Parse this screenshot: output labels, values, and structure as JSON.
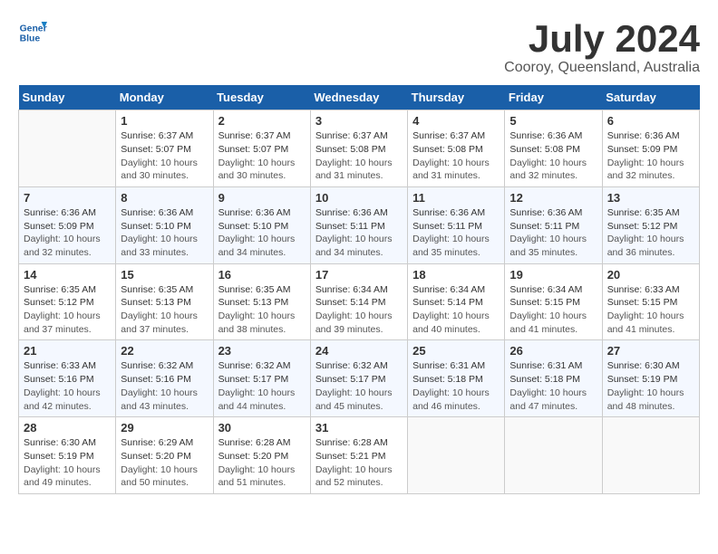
{
  "header": {
    "logo_line1": "General",
    "logo_line2": "Blue",
    "month": "July 2024",
    "location": "Cooroy, Queensland, Australia"
  },
  "days_of_week": [
    "Sunday",
    "Monday",
    "Tuesday",
    "Wednesday",
    "Thursday",
    "Friday",
    "Saturday"
  ],
  "weeks": [
    [
      {
        "day": "",
        "info": ""
      },
      {
        "day": "1",
        "sunrise": "Sunrise: 6:37 AM",
        "sunset": "Sunset: 5:07 PM",
        "daylight": "Daylight: 10 hours and 30 minutes."
      },
      {
        "day": "2",
        "sunrise": "Sunrise: 6:37 AM",
        "sunset": "Sunset: 5:07 PM",
        "daylight": "Daylight: 10 hours and 30 minutes."
      },
      {
        "day": "3",
        "sunrise": "Sunrise: 6:37 AM",
        "sunset": "Sunset: 5:08 PM",
        "daylight": "Daylight: 10 hours and 31 minutes."
      },
      {
        "day": "4",
        "sunrise": "Sunrise: 6:37 AM",
        "sunset": "Sunset: 5:08 PM",
        "daylight": "Daylight: 10 hours and 31 minutes."
      },
      {
        "day": "5",
        "sunrise": "Sunrise: 6:36 AM",
        "sunset": "Sunset: 5:08 PM",
        "daylight": "Daylight: 10 hours and 32 minutes."
      },
      {
        "day": "6",
        "sunrise": "Sunrise: 6:36 AM",
        "sunset": "Sunset: 5:09 PM",
        "daylight": "Daylight: 10 hours and 32 minutes."
      }
    ],
    [
      {
        "day": "7",
        "sunrise": "Sunrise: 6:36 AM",
        "sunset": "Sunset: 5:09 PM",
        "daylight": "Daylight: 10 hours and 32 minutes."
      },
      {
        "day": "8",
        "sunrise": "Sunrise: 6:36 AM",
        "sunset": "Sunset: 5:10 PM",
        "daylight": "Daylight: 10 hours and 33 minutes."
      },
      {
        "day": "9",
        "sunrise": "Sunrise: 6:36 AM",
        "sunset": "Sunset: 5:10 PM",
        "daylight": "Daylight: 10 hours and 34 minutes."
      },
      {
        "day": "10",
        "sunrise": "Sunrise: 6:36 AM",
        "sunset": "Sunset: 5:11 PM",
        "daylight": "Daylight: 10 hours and 34 minutes."
      },
      {
        "day": "11",
        "sunrise": "Sunrise: 6:36 AM",
        "sunset": "Sunset: 5:11 PM",
        "daylight": "Daylight: 10 hours and 35 minutes."
      },
      {
        "day": "12",
        "sunrise": "Sunrise: 6:36 AM",
        "sunset": "Sunset: 5:11 PM",
        "daylight": "Daylight: 10 hours and 35 minutes."
      },
      {
        "day": "13",
        "sunrise": "Sunrise: 6:35 AM",
        "sunset": "Sunset: 5:12 PM",
        "daylight": "Daylight: 10 hours and 36 minutes."
      }
    ],
    [
      {
        "day": "14",
        "sunrise": "Sunrise: 6:35 AM",
        "sunset": "Sunset: 5:12 PM",
        "daylight": "Daylight: 10 hours and 37 minutes."
      },
      {
        "day": "15",
        "sunrise": "Sunrise: 6:35 AM",
        "sunset": "Sunset: 5:13 PM",
        "daylight": "Daylight: 10 hours and 37 minutes."
      },
      {
        "day": "16",
        "sunrise": "Sunrise: 6:35 AM",
        "sunset": "Sunset: 5:13 PM",
        "daylight": "Daylight: 10 hours and 38 minutes."
      },
      {
        "day": "17",
        "sunrise": "Sunrise: 6:34 AM",
        "sunset": "Sunset: 5:14 PM",
        "daylight": "Daylight: 10 hours and 39 minutes."
      },
      {
        "day": "18",
        "sunrise": "Sunrise: 6:34 AM",
        "sunset": "Sunset: 5:14 PM",
        "daylight": "Daylight: 10 hours and 40 minutes."
      },
      {
        "day": "19",
        "sunrise": "Sunrise: 6:34 AM",
        "sunset": "Sunset: 5:15 PM",
        "daylight": "Daylight: 10 hours and 41 minutes."
      },
      {
        "day": "20",
        "sunrise": "Sunrise: 6:33 AM",
        "sunset": "Sunset: 5:15 PM",
        "daylight": "Daylight: 10 hours and 41 minutes."
      }
    ],
    [
      {
        "day": "21",
        "sunrise": "Sunrise: 6:33 AM",
        "sunset": "Sunset: 5:16 PM",
        "daylight": "Daylight: 10 hours and 42 minutes."
      },
      {
        "day": "22",
        "sunrise": "Sunrise: 6:32 AM",
        "sunset": "Sunset: 5:16 PM",
        "daylight": "Daylight: 10 hours and 43 minutes."
      },
      {
        "day": "23",
        "sunrise": "Sunrise: 6:32 AM",
        "sunset": "Sunset: 5:17 PM",
        "daylight": "Daylight: 10 hours and 44 minutes."
      },
      {
        "day": "24",
        "sunrise": "Sunrise: 6:32 AM",
        "sunset": "Sunset: 5:17 PM",
        "daylight": "Daylight: 10 hours and 45 minutes."
      },
      {
        "day": "25",
        "sunrise": "Sunrise: 6:31 AM",
        "sunset": "Sunset: 5:18 PM",
        "daylight": "Daylight: 10 hours and 46 minutes."
      },
      {
        "day": "26",
        "sunrise": "Sunrise: 6:31 AM",
        "sunset": "Sunset: 5:18 PM",
        "daylight": "Daylight: 10 hours and 47 minutes."
      },
      {
        "day": "27",
        "sunrise": "Sunrise: 6:30 AM",
        "sunset": "Sunset: 5:19 PM",
        "daylight": "Daylight: 10 hours and 48 minutes."
      }
    ],
    [
      {
        "day": "28",
        "sunrise": "Sunrise: 6:30 AM",
        "sunset": "Sunset: 5:19 PM",
        "daylight": "Daylight: 10 hours and 49 minutes."
      },
      {
        "day": "29",
        "sunrise": "Sunrise: 6:29 AM",
        "sunset": "Sunset: 5:20 PM",
        "daylight": "Daylight: 10 hours and 50 minutes."
      },
      {
        "day": "30",
        "sunrise": "Sunrise: 6:28 AM",
        "sunset": "Sunset: 5:20 PM",
        "daylight": "Daylight: 10 hours and 51 minutes."
      },
      {
        "day": "31",
        "sunrise": "Sunrise: 6:28 AM",
        "sunset": "Sunset: 5:21 PM",
        "daylight": "Daylight: 10 hours and 52 minutes."
      },
      {
        "day": "",
        "info": ""
      },
      {
        "day": "",
        "info": ""
      },
      {
        "day": "",
        "info": ""
      }
    ]
  ]
}
